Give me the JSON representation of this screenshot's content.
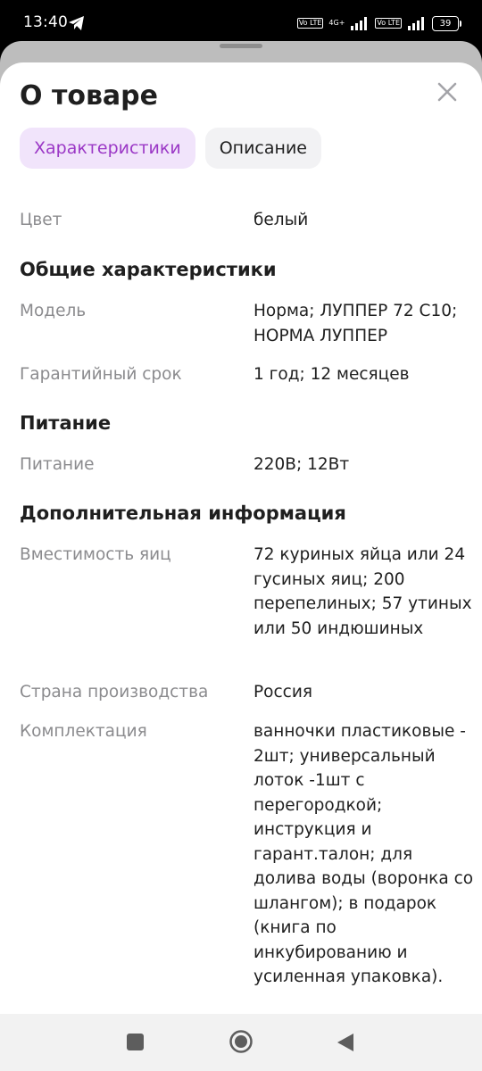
{
  "status": {
    "time": "13:40",
    "volte1": "Vo LTE",
    "network": "4G+",
    "volte2": "Vo LTE",
    "battery": "39"
  },
  "sheet": {
    "title": "О товаре",
    "tabs": [
      {
        "label": "Характеристики",
        "active": true
      },
      {
        "label": "Описание",
        "active": false
      }
    ]
  },
  "specs": {
    "top_rows": [
      {
        "label": "Цвет",
        "value": "белый"
      }
    ],
    "sections": [
      {
        "title": "Общие характеристики",
        "rows": [
          {
            "label": "Модель",
            "value": "Норма; ЛУППЕР 72 С10; НОРМА ЛУППЕР"
          },
          {
            "label": "Гарантийный срок",
            "value": "1 год; 12 месяцев"
          }
        ]
      },
      {
        "title": "Питание",
        "rows": [
          {
            "label": "Питание",
            "value": "220В; 12Вт"
          }
        ]
      },
      {
        "title": "Дополнительная информация",
        "rows": [
          {
            "label": "Вместимость яиц",
            "value": "72 куриных яйца или 24 гусиных яиц; 200 перепелиных; 57 утиных или 50 индюшиных"
          },
          {
            "label": "Страна производства",
            "value": "Россия"
          },
          {
            "label": "Комплектация",
            "value": "ванночки пластиковые - 2шт; универсальный лоток -1шт с перегородкой; инструкция и гарант.талон; для долива воды (воронка со шлангом); в подарок (книга по инкубированию и усиленная упаковка)."
          }
        ]
      }
    ]
  },
  "icons": {
    "close": "close-icon",
    "telegram": "telegram-icon",
    "nav_recent": "recent-apps-icon",
    "nav_home": "home-icon",
    "nav_back": "back-icon"
  },
  "colors": {
    "accent": "#9b38c6",
    "accent_bg": "#f1e4fb",
    "label_gray": "#8b8b8e"
  }
}
